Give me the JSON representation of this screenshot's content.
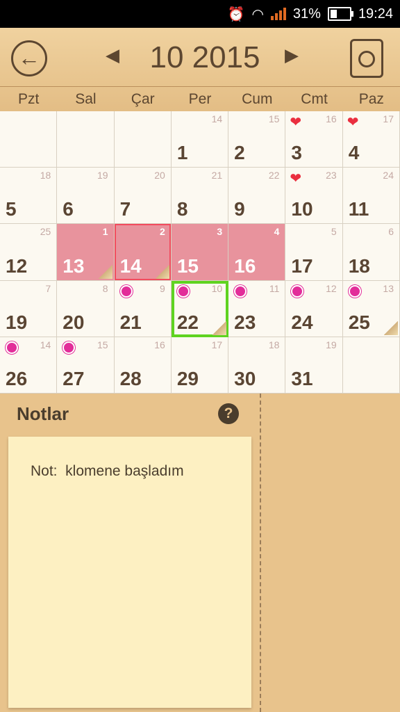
{
  "status": {
    "battery": "31%",
    "time": "19:24",
    "icons": [
      "alarm-icon",
      "wifi-icon",
      "signal-icon",
      "battery-icon"
    ]
  },
  "header": {
    "month_year": "10 2015",
    "back_icon": "back-arrow-icon",
    "prev_icon": "prev-arrow-icon",
    "next_icon": "next-arrow-icon",
    "doc_icon": "report-icon"
  },
  "weekdays": [
    "Pzt",
    "Sal",
    "Çar",
    "Per",
    "Cum",
    "Cmt",
    "Paz"
  ],
  "days": [
    {
      "d": "",
      "l": ""
    },
    {
      "d": "",
      "l": ""
    },
    {
      "d": "",
      "l": ""
    },
    {
      "d": "1",
      "l": "14"
    },
    {
      "d": "2",
      "l": "15"
    },
    {
      "d": "3",
      "l": "16",
      "heart": true
    },
    {
      "d": "4",
      "l": "17",
      "heart": true
    },
    {
      "d": "5",
      "l": "18"
    },
    {
      "d": "6",
      "l": "19"
    },
    {
      "d": "7",
      "l": "20"
    },
    {
      "d": "8",
      "l": "21"
    },
    {
      "d": "9",
      "l": "22"
    },
    {
      "d": "10",
      "l": "23",
      "heart": true
    },
    {
      "d": "11",
      "l": "24"
    },
    {
      "d": "12",
      "l": "25"
    },
    {
      "d": "13",
      "l": "1",
      "period": true,
      "note": true
    },
    {
      "d": "14",
      "l": "2",
      "period": true,
      "note": true,
      "border": true
    },
    {
      "d": "15",
      "l": "3",
      "period": true
    },
    {
      "d": "16",
      "l": "4",
      "period": true
    },
    {
      "d": "17",
      "l": "5"
    },
    {
      "d": "18",
      "l": "6"
    },
    {
      "d": "19",
      "l": "7"
    },
    {
      "d": "20",
      "l": "8"
    },
    {
      "d": "21",
      "l": "9",
      "dot": true
    },
    {
      "d": "22",
      "l": "10",
      "dot": true,
      "selected": true,
      "note": true
    },
    {
      "d": "23",
      "l": "11",
      "dot": true
    },
    {
      "d": "24",
      "l": "12",
      "dot": true
    },
    {
      "d": "25",
      "l": "13",
      "dot": true,
      "note": true
    },
    {
      "d": "26",
      "l": "14",
      "dot": true
    },
    {
      "d": "27",
      "l": "15",
      "dot": true
    },
    {
      "d": "28",
      "l": "16"
    },
    {
      "d": "29",
      "l": "17"
    },
    {
      "d": "30",
      "l": "18"
    },
    {
      "d": "31",
      "l": "19"
    },
    {
      "d": "",
      "l": ""
    }
  ],
  "notes": {
    "title": "Notlar",
    "help_icon": "help-icon",
    "text": "Not:  klomene başladım"
  }
}
